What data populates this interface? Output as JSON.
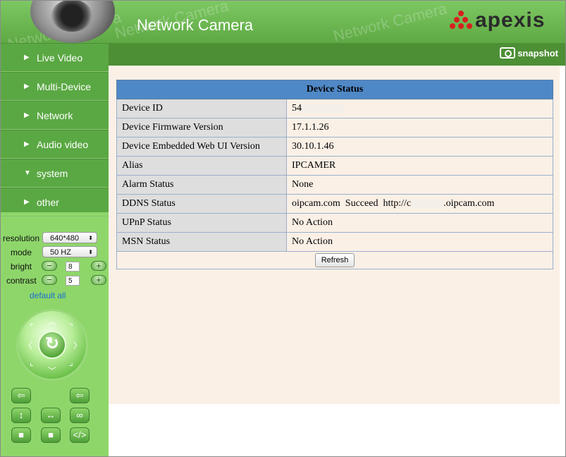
{
  "header": {
    "app_title": "Network Camera",
    "watermark": "Network Camera",
    "logo_text": "apexis",
    "colors": {
      "header_green": "#6bb650",
      "logo_red": "#d71f1f"
    }
  },
  "sidebar": {
    "nav": [
      {
        "label": "Live Video",
        "arrow": "▶"
      },
      {
        "label": "Multi-Device",
        "arrow": "▶"
      },
      {
        "label": "Network",
        "arrow": "▶"
      },
      {
        "label": "Audio video",
        "arrow": "▶"
      },
      {
        "label": "system",
        "arrow": "▼"
      },
      {
        "label": "other",
        "arrow": "▶"
      }
    ],
    "controls": {
      "resolution_label": "resolution",
      "resolution_value": "640*480",
      "mode_label": "mode",
      "mode_value": "50 HZ",
      "bright_label": "bright",
      "bright_value": "8",
      "contrast_label": "contrast",
      "contrast_value": "5",
      "default_link": "default all"
    }
  },
  "topbar": {
    "snapshot_label": "snapshot"
  },
  "status": {
    "title": "Device Status",
    "rows": [
      {
        "label": "Device ID",
        "value": "54"
      },
      {
        "label": "Device Firmware Version",
        "value": "17.1.1.26"
      },
      {
        "label": "Device Embedded Web UI Version",
        "value": "30.10.1.46"
      },
      {
        "label": "Alias",
        "value": "IPCAMER"
      },
      {
        "label": "Alarm Status",
        "value": "None"
      },
      {
        "label": "DDNS Status",
        "value": "oipcam.com  Succeed  http://c",
        "value_suffix": ".oipcam.com"
      },
      {
        "label": "UPnP Status",
        "value": "No Action"
      },
      {
        "label": "MSN Status",
        "value": "No Action"
      }
    ],
    "refresh_label": "Refresh"
  }
}
